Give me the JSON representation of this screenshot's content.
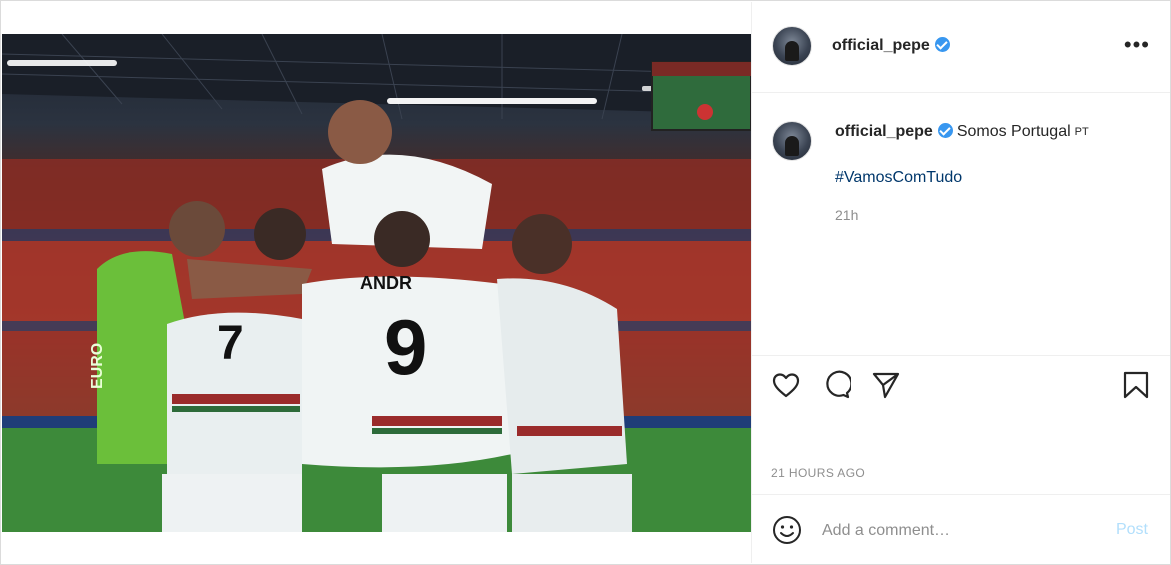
{
  "post": {
    "username": "official_pepe",
    "caption_text": "Somos Portugal",
    "caption_flag": "PT",
    "hashtag": "#VamosComTudo",
    "time_ago": "21h",
    "posted_label": "21 HOURS AGO",
    "more_label": "•••"
  },
  "comment": {
    "placeholder": "Add a comment…",
    "post_label": "Post"
  },
  "photo": {
    "jersey_name": "ANDR",
    "jersey_number": "9",
    "left_number": "7",
    "bib_text": "EURO"
  },
  "icons": {
    "verified": "verified-badge-icon",
    "more": "more-options-icon",
    "like": "heart-icon",
    "comment": "comment-bubble-icon",
    "share": "paper-plane-icon",
    "save": "bookmark-icon",
    "emoji": "smiley-icon"
  },
  "colors": {
    "link": "#00376b",
    "verified": "#3897f0",
    "post_button": "#b2dffc",
    "muted": "#8e8e8e"
  }
}
